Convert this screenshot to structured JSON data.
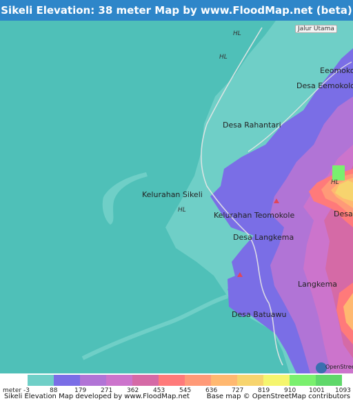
{
  "header": {
    "title": "Sikeli Elevation: 38 meter Map by www.FloodMap.net (beta)",
    "background": "#2e86c9"
  },
  "map": {
    "colors": {
      "sea": "#4fc0b8",
      "lowland": "#6fcfc7",
      "marker": "#e0465a"
    },
    "places": [
      {
        "name": "Kelurahan Sikeli"
      },
      {
        "name": "Kelurahan Teomokole"
      },
      {
        "name": "Desa Rahantari"
      },
      {
        "name": "Desa Eemokolo"
      },
      {
        "name": "Eeomokolo"
      },
      {
        "name": "Desa Langkema"
      },
      {
        "name": "Langkema"
      },
      {
        "name": "Desa Batuawu"
      },
      {
        "name": "Desa T"
      }
    ],
    "road_label": "Jalur Utama",
    "hl_labels": [
      "HL",
      "HL",
      "HL",
      "HL"
    ],
    "osm_badge": "OpenStreetMap"
  },
  "legend": {
    "unit_label": "meter",
    "values": [
      "-3",
      "88",
      "179",
      "271",
      "362",
      "453",
      "545",
      "636",
      "727",
      "819",
      "910",
      "1001",
      "1093"
    ],
    "colors": [
      "#6fcfc7",
      "#7a6ee6",
      "#b174d6",
      "#cc74cc",
      "#d56aa6",
      "#ff7a7a",
      "#ff9a78",
      "#ffb870",
      "#f7d46e",
      "#f5f56e",
      "#7af06e",
      "#5fd86a"
    ]
  },
  "footer": {
    "left": "Sikeli Elevation Map developed by www.FloodMap.net",
    "right": "Base map © OpenStreetMap contributors"
  }
}
